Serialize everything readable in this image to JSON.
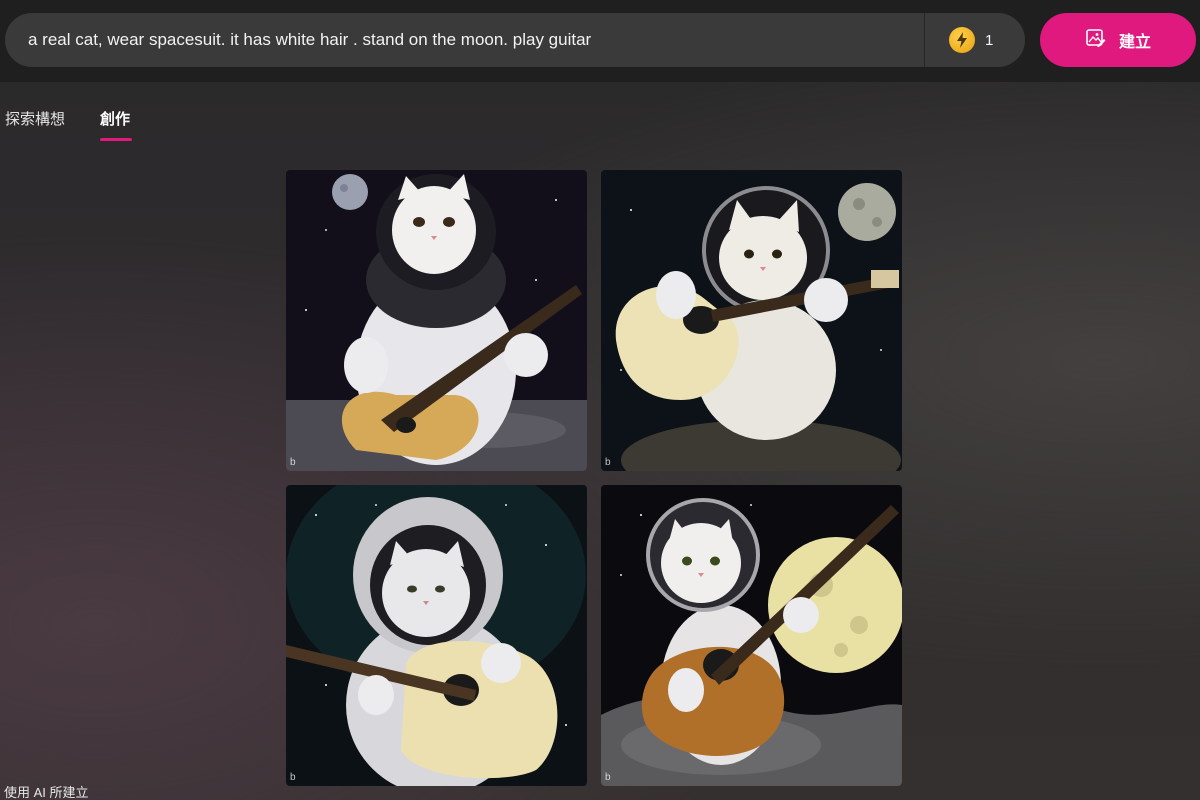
{
  "search": {
    "prompt": "a real cat, wear spacesuit. it has white hair . stand on the moon. play guitar",
    "boost_icon": "lightning-bolt-icon",
    "boost_count": "1",
    "create_button_label": "建立",
    "create_button_icon": "image-edit-icon"
  },
  "tabs": [
    {
      "label": "探索構想",
      "active": false
    },
    {
      "label": "創作",
      "active": true
    }
  ],
  "accent_color": "#e0197f",
  "images": [
    {
      "watermark": "b"
    },
    {
      "watermark": "b"
    },
    {
      "watermark": "b"
    },
    {
      "watermark": "b"
    }
  ],
  "footer": {
    "note": "使用 AI 所建立"
  }
}
